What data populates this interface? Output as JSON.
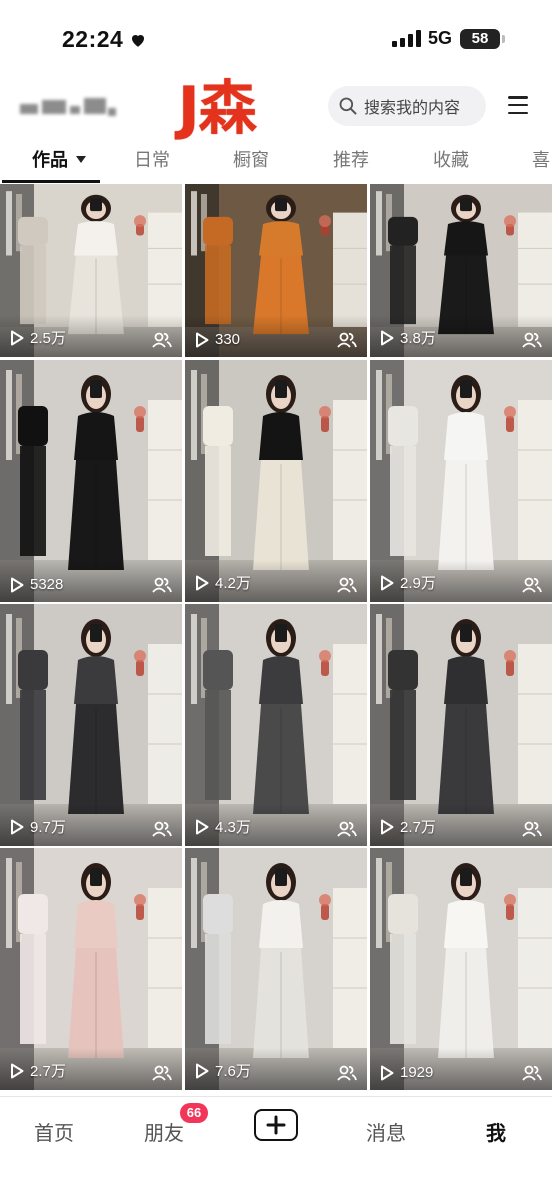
{
  "status_bar": {
    "time": "22:24",
    "network": "5G",
    "battery": "58"
  },
  "header": {
    "brand": "J森",
    "brand_color": "#e4321c",
    "search_placeholder": "搜索我的内容",
    "icons": [
      "search-icon",
      "menu-icon"
    ]
  },
  "tabs": [
    {
      "label": "作品",
      "active": true
    },
    {
      "label": "日常"
    },
    {
      "label": "橱窗"
    },
    {
      "label": "推荐"
    },
    {
      "label": "收藏"
    },
    {
      "label": "喜"
    }
  ],
  "videos": [
    {
      "plays": "2.5万"
    },
    {
      "plays": "330"
    },
    {
      "plays": "3.8万"
    },
    {
      "plays": "5328"
    },
    {
      "plays": "4.2万"
    },
    {
      "plays": "2.9万"
    },
    {
      "plays": "9.7万"
    },
    {
      "plays": "4.3万"
    },
    {
      "plays": "2.7万"
    },
    {
      "plays": "2.7万"
    },
    {
      "plays": "7.6万"
    },
    {
      "plays": "1929"
    }
  ],
  "bottom_nav": {
    "home": "首页",
    "friends": "朋友",
    "friends_badge": "66",
    "messages": "消息",
    "me": "我"
  }
}
